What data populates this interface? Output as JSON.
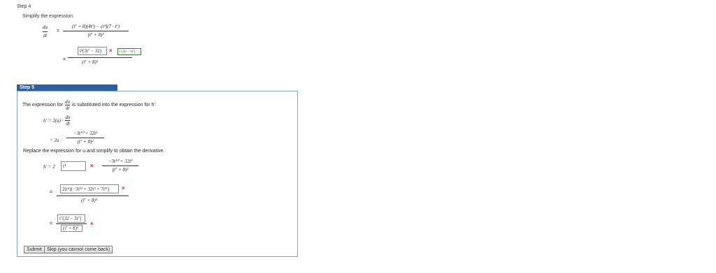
{
  "step4": {
    "heading": "Step 4",
    "instruction": "Simplify the expression.",
    "lhs_num": "du",
    "lhs_den": "dt",
    "eq": "=",
    "line1_num": "(t⁷ + 8)(4t³) − (t⁴)(7 · t⁶)",
    "line1_den": "(t⁷ + 8)²",
    "line2_input": "t³(3t⁷ − 32)",
    "line2_input_b": "t·(32 − 3t⁷)",
    "line2_den": "(t⁷ + 8)²"
  },
  "step5": {
    "tab_label": "Step 5",
    "sentence_a": "The expression for",
    "sentence_frac_num": "du",
    "sentence_frac_den": "dt",
    "sentence_b": "is substituted into the expression for h′.",
    "h_lhs": "h′ = 2(u) ·",
    "h_frac_num": "du",
    "h_frac_den": "dt",
    "sub_lhs": "= 2u ·",
    "sub_num": "−3t¹⁰ + 32t³",
    "sub_den": "(t⁷ + 8)²",
    "replace_text": "Replace the expression for u and simplify to obtain the derivative.",
    "h2_lhs": "h′ = 2",
    "h2_input": "t⁴",
    "h2_dot": "·",
    "h2_num": "−3t¹⁰ + 32t³",
    "h2_den": "(t⁷ + 8)²",
    "eq_a": "=",
    "big_input": "2(t⁴)(−3t¹⁰ + 32t³ + 7t¹¹)",
    "big_den": "(t⁷ + 8)³",
    "eq_b": "=",
    "last_num_input": "t⁷(32 − 3t⁷)",
    "last_den_input": "(t⁷ + 8)²",
    "submit_label": "Submit",
    "skip_label": "Skip (you cannot come back)"
  },
  "marks": {
    "wrong": "×"
  },
  "colors": {
    "tab_bg": "#2f5ea3",
    "panel_border": "#7ea0cf",
    "wrong_mark": "#d0202a",
    "correct_box": "#2a8a2a"
  }
}
